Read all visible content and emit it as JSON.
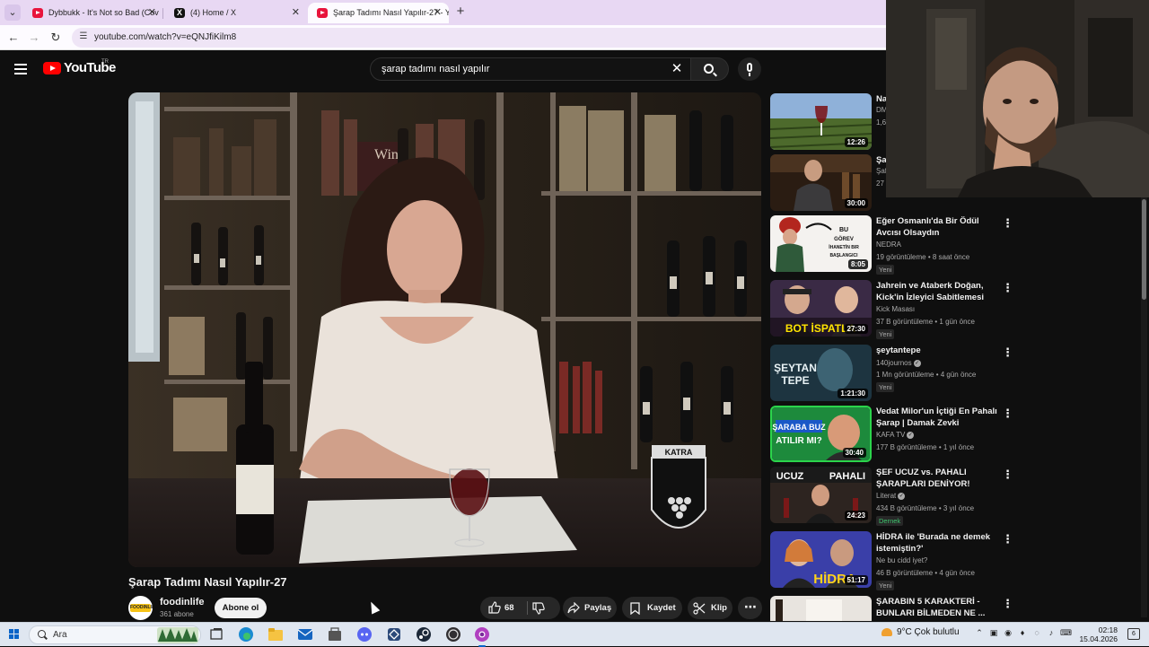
{
  "browser": {
    "tabs": [
      {
        "label": "Dybbukk - It's Not so Bad (Cov",
        "icon": "youtube-icon"
      },
      {
        "label": "(4) Home / X",
        "icon": "x-icon"
      },
      {
        "label": "Şarap Tadımı Nasıl Yapılır-27 - Y",
        "icon": "youtube-icon",
        "active": true
      }
    ],
    "new_tab": "+",
    "url": "youtube.com/watch?v=eQNJfiKilm8"
  },
  "youtube": {
    "logo_text": "YouTube",
    "country": "TR",
    "search_query": "şarap tadımı nasıl yapılır"
  },
  "video": {
    "title": "Şarap Tadımı Nasıl Yapılır-27",
    "scene_text": "Wine",
    "logo_text": "KATRA",
    "channel": {
      "name": "foodinlife",
      "subscribers": "361 abone",
      "avatar_text": "FOODINLIFE"
    },
    "subscribe_label": "Abone ol",
    "likes": "68",
    "share_label": "Paylaş",
    "save_label": "Kaydet",
    "clip_label": "Klip"
  },
  "recommendations": [
    {
      "title": "Na",
      "channel": "DM",
      "meta": "1,6",
      "duration": "12:26",
      "badge": ""
    },
    {
      "title": "Şa",
      "channel": "Şaf",
      "meta": "27",
      "duration": "30:00",
      "badge": ""
    },
    {
      "title": "Eğer Osmanlı'da Bir Ödül Avcısı Olsaydın",
      "channel": "NEDRA",
      "meta": "19 görüntüleme • 8 saat önce",
      "duration": "8:05",
      "badge": "Yeni",
      "thumb_text": "BU GÖREV İHANETİN BIR BAŞLANGICI"
    },
    {
      "title": "Jahrein ve Ataberk Doğan, Kick'in İzleyici Sabitlemesi Ola...",
      "channel": "Kick Masası",
      "meta": "37 B görüntüleme • 1 gün önce",
      "duration": "27:30",
      "badge": "Yeni",
      "thumb_text": "BOT İSPATLA"
    },
    {
      "title": "şeytantepe",
      "channel": "140journos",
      "verified": true,
      "meta": "1 Mn görüntüleme • 4 gün önce",
      "duration": "1:21:30",
      "badge": "Yeni",
      "thumb_text": "ŞEYTAN TEPE"
    },
    {
      "title": "Vedat Milor'un İçtiği En Pahalı Şarap | Damak Zevki",
      "channel": "KAFA TV",
      "verified": true,
      "meta": "177 B görüntüleme • 1 yıl önce",
      "duration": "30:40",
      "badge": "",
      "thumb_text": "ŞARABA BUZ ATILIR MI?"
    },
    {
      "title": "ŞEF UCUZ vs. PAHALI ŞARAPLARI DENİYOR!",
      "channel": "Literat",
      "verified": true,
      "meta": "434 B görüntüleme • 3 yıl önce",
      "duration": "24:23",
      "badge": "Dernek",
      "thumb_text": "UCUZ PAHALI"
    },
    {
      "title": "HİDRA ile 'Burada ne demek istemiştin?'",
      "channel": "Ne bu cidd iyet?",
      "meta": "46 B görüntüleme • 4 gün önce",
      "duration": "51:17",
      "badge": "Yeni",
      "thumb_text": "HİDRA"
    },
    {
      "title": "ŞARABIN 5 KARAKTERİ - BUNLARI BİLMEDEN NE ...",
      "channel": "",
      "meta": "",
      "duration": "",
      "badge": ""
    }
  ],
  "taskbar": {
    "search_placeholder": "Ara",
    "weather": "9°C  Çok bulutlu",
    "time": "02:18",
    "date": "15.04.2026",
    "notifications": "6"
  },
  "colors": {
    "youtube_red": "#ff0000",
    "background": "#0f0f0f",
    "tab_strip": "#e8d8f3",
    "new_badge_green": "#3ec46d"
  }
}
